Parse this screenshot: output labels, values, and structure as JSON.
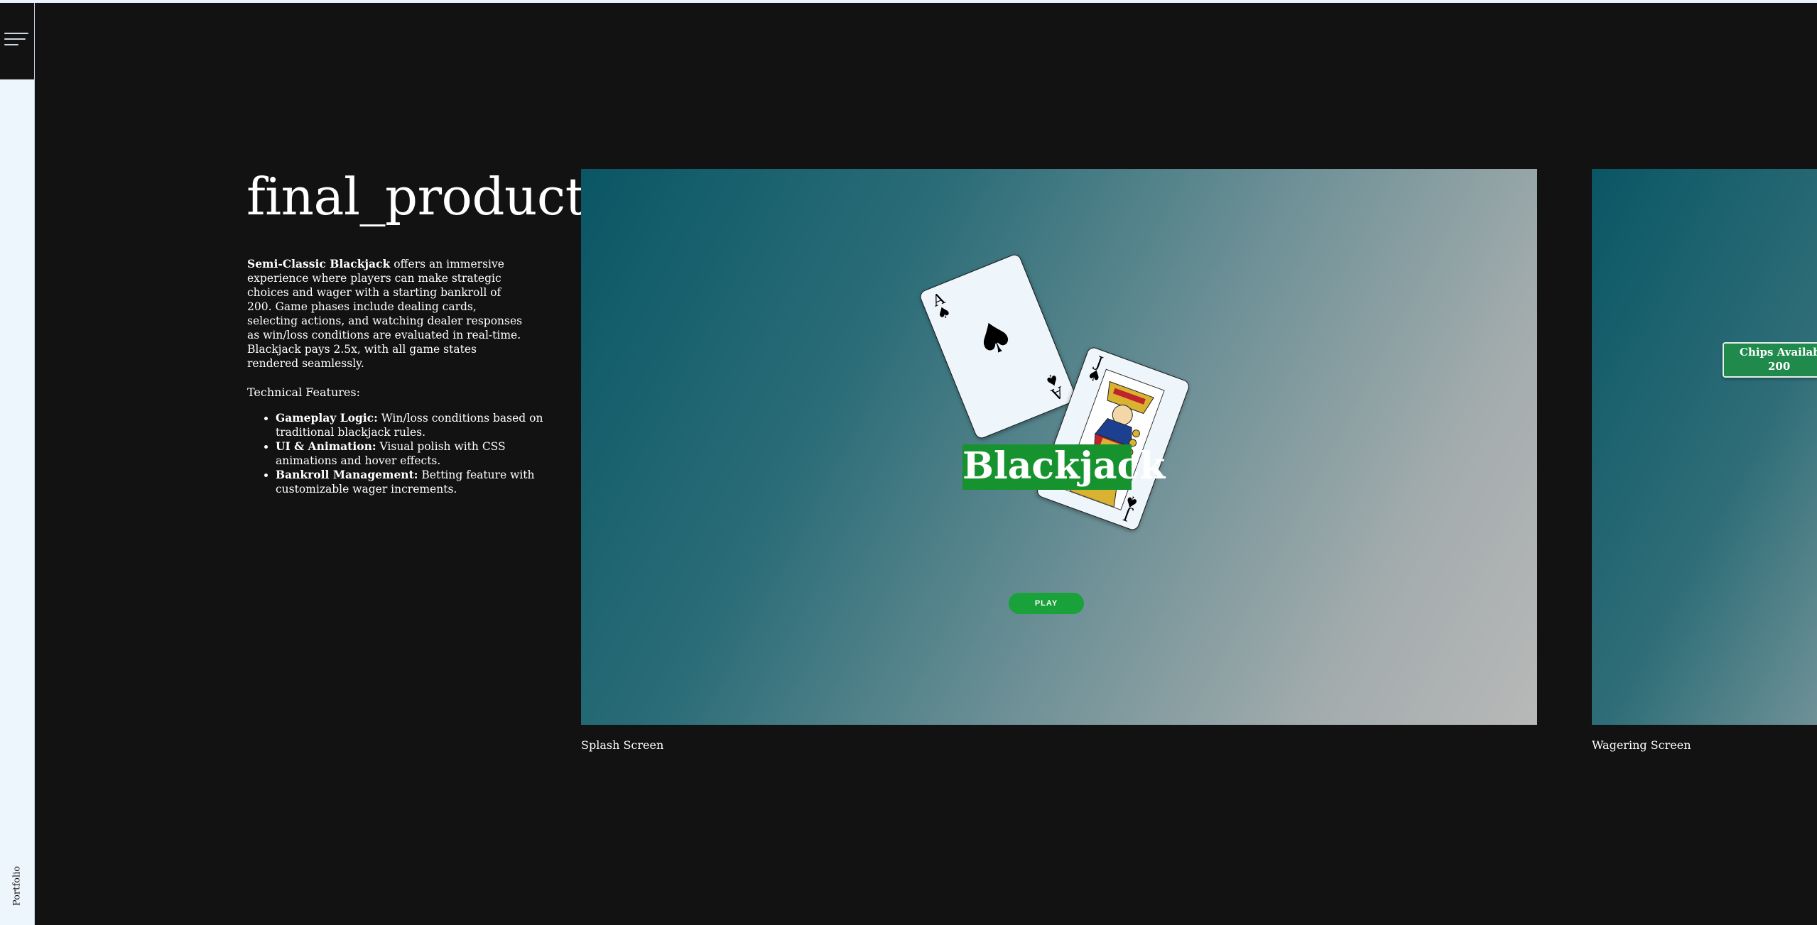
{
  "nav": {
    "menu_icon": "hamburger-icon",
    "rail_label": "Portfolio"
  },
  "intro": {
    "title": "final_product",
    "desc_bold": "Semi-Classic Blackjack",
    "desc_rest": " offers an immersive experience where players can make strategic choices and wager with a starting bankroll of 200. Game phases include dealing cards, selecting actions, and watching dealer responses as win/loss conditions are evaluated in real-time. Blackjack pays 2.5x, with all game states rendered seamlessly.",
    "features_heading": "Technical Features:",
    "features": [
      {
        "label": "Gameplay Logic:",
        "text": " Win/loss conditions based on traditional blackjack rules."
      },
      {
        "label": "UI & Animation:",
        "text": " Visual polish with CSS animations and hover effects."
      },
      {
        "label": "Bankroll Management:",
        "text": " Betting feature with customizable wager increments."
      }
    ]
  },
  "slides": [
    {
      "caption": "Splash Screen",
      "brand": "Blackjack",
      "play_label": "PLAY",
      "cards": [
        {
          "rank": "A",
          "suit": "♠"
        },
        {
          "rank": "J",
          "suit": "♠"
        }
      ]
    },
    {
      "caption": "Wagering Screen",
      "chips_label": "Chips Available",
      "chips_value": "200"
    }
  ],
  "colors": {
    "background": "#121212",
    "accent_green": "#19a13a",
    "rail": "#eef6fd"
  }
}
